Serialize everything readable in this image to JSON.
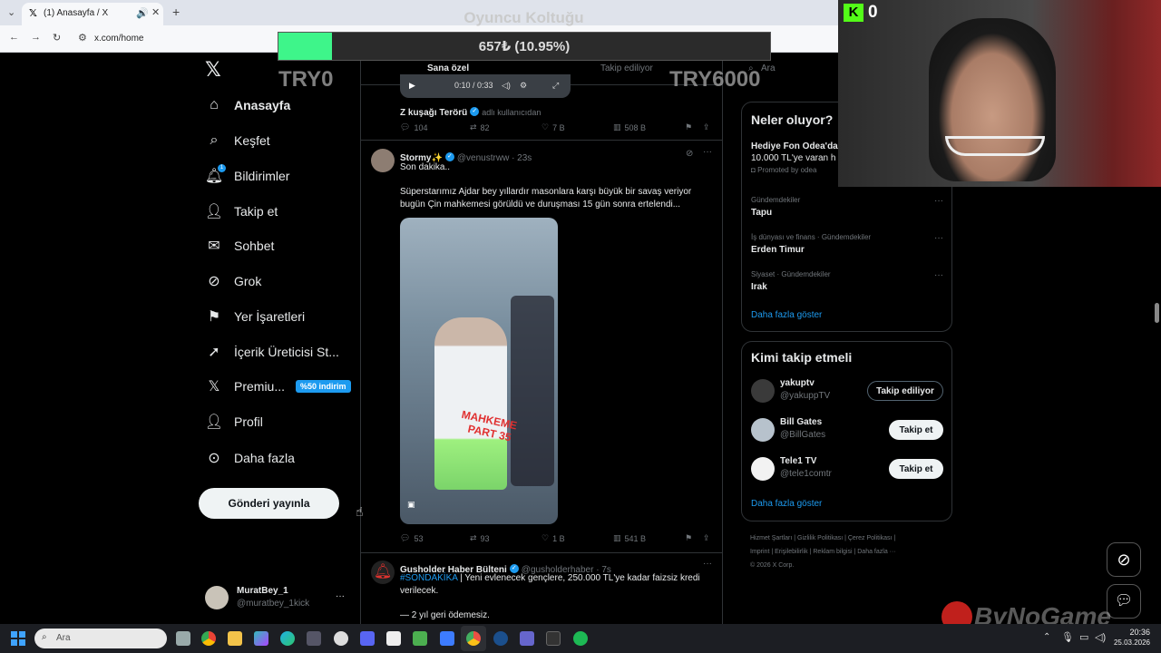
{
  "browser": {
    "tab_title": "(1) Anasayfa / X",
    "url": "x.com/home"
  },
  "overlay": {
    "title": "Oyuncu Koltuğu",
    "progress_text": "657₺ (10.95%)",
    "progress_fraction": 0.1095,
    "left_label": "TRY0",
    "right_label": "TRY6000",
    "color": "#3ef58a"
  },
  "nav": {
    "items": [
      {
        "label": "Anasayfa",
        "icon": "home-icon"
      },
      {
        "label": "Keşfet",
        "icon": "search-icon"
      },
      {
        "label": "Bildirimler",
        "icon": "bell-icon",
        "badge": "1"
      },
      {
        "label": "Takip et",
        "icon": "add-user-icon"
      },
      {
        "label": "Sohbet",
        "icon": "mail-icon"
      },
      {
        "label": "Grok",
        "icon": "grok-icon"
      },
      {
        "label": "Yer İşaretleri",
        "icon": "bookmark-icon"
      },
      {
        "label": "İçerik Üreticisi St...",
        "icon": "rocket-icon"
      },
      {
        "label": "Premiu...",
        "icon": "x-logo-icon",
        "promo": "%50 indirim"
      },
      {
        "label": "Profil",
        "icon": "person-icon"
      },
      {
        "label": "Daha fazla",
        "icon": "more-circle-icon"
      }
    ],
    "post_button": "Gönderi yayınla"
  },
  "account": {
    "name": "MuratBey_1",
    "handle": "@muratbey_1kick",
    "more": "···"
  },
  "feed": {
    "tabs": [
      "Sana özel",
      "Takip ediliyor"
    ],
    "media_time": "0:10 / 0:33",
    "tweet0": {
      "quote_name": "Z kuşağı Terörü",
      "quote_note": "adlı kullanıcıdan",
      "replies": "104",
      "reposts": "82",
      "likes": "7 B",
      "views": "508 B"
    },
    "tweet1": {
      "name": "Stormy✨",
      "handle": "@venustrww · 23s",
      "line1": "Son dakika..",
      "line2": "Süperstarımız Ajdar bey yıllardır masonlara karşı büyük bir savaş veriyor bugün Çin mahkemesi görüldü ve duruşması 15 gün sonra ertelendi...",
      "overlay_text1": "MAHKEME",
      "overlay_text2": "PART 35",
      "replies": "53",
      "reposts": "93",
      "likes": "1 B",
      "views": "541 B"
    },
    "tweet2": {
      "name": "Gusholder Haber Bülteni",
      "handle": "@gusholderhaber · 7s",
      "hashtag": "#SONDAKİKA",
      "text": " | Yeni evlenecek gençlere, 250.000 TL'ye kadar faizsiz kredi verilecek.",
      "line2": "— 2 yıl geri ödemesiz."
    }
  },
  "right": {
    "search_placeholder": "Ara",
    "trends": {
      "title": "Neler oluyor?",
      "promo_title": "Hediye Fon Odea'da",
      "promo_sub": "10.000 TL'ye varan h",
      "promo_by": "Promoted by odea",
      "items": [
        {
          "meta": "Gündemdekiler",
          "title": "Tapu"
        },
        {
          "meta": "İş dünyası ve finans · Gündemdekiler",
          "title": "Erden Timur"
        },
        {
          "meta": "Siyaset · Gündemdekiler",
          "title": "Irak"
        }
      ],
      "more": "Daha fazla göster"
    },
    "who_to_follow": {
      "title": "Kimi takip etmeli",
      "users": [
        {
          "name": "yakuptv",
          "handle": "@yakuppTV",
          "button": "Takip ediliyor"
        },
        {
          "name": "Bill Gates",
          "handle": "@BillGates",
          "button": "Takip et"
        },
        {
          "name": "Tele1 TV",
          "handle": "@tele1comtr",
          "button": "Takip et"
        }
      ],
      "more": "Daha fazla göster"
    },
    "footer": {
      "line1": "Hizmet Şartları  |  Gizlilik Politikası  |  Çerez Politikası  |",
      "line2": "Imprint  |  Erişilebilirlik  |  Reklam bilgisi  |  Daha fazla ···",
      "line3": "© 2026 X Corp."
    }
  },
  "webcam": {
    "kick_label": "0"
  },
  "watermark": "ByNoGame",
  "taskbar": {
    "search_placeholder": "Ara",
    "time": "20:36",
    "date": "25.03.2026"
  }
}
